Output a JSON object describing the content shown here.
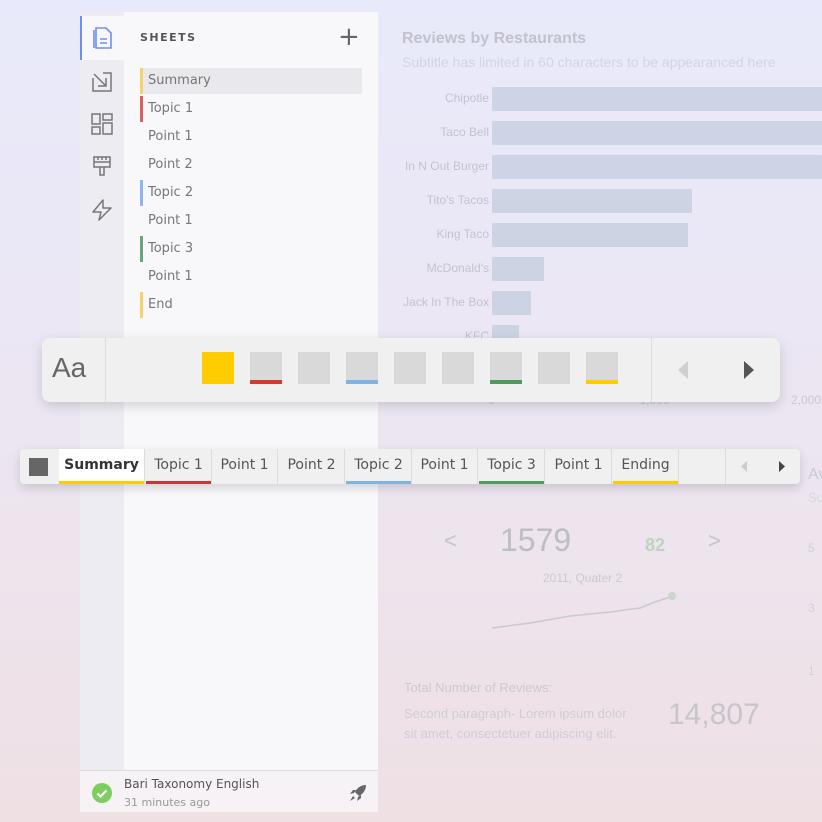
{
  "chart_data": {
    "type": "bar",
    "title": "Reviews by Restaurants",
    "subtitle": "Subtitle has limited in 60 characters to be appearanced here",
    "categories": [
      "Chipotle",
      "Taco Bell",
      "In N Out Burger",
      "Tito's Tacos",
      "King Taco",
      "McDonald's",
      "Jack In The Box",
      "KFC"
    ],
    "values": [
      2400,
      2400,
      2400,
      1320,
      1295,
      340,
      255,
      175
    ],
    "xticks": [
      "0",
      "1,000",
      "2,000"
    ],
    "xlim": [
      0,
      2000
    ],
    "orientation": "horizontal",
    "bar_color": "#c9d2e2"
  },
  "kpi": {
    "value": "1579",
    "delta": "82",
    "period": "2011, Quater 2",
    "prev": "<",
    "next": ">"
  },
  "total": {
    "label": "Total Number of Reviews:",
    "desc": "Second paragraph- Lorem ipsum dolor sit amet, consectetuer adipiscing elit.",
    "value": "14,807"
  },
  "right_peek": {
    "title": "Av",
    "sub": "Su",
    "ticks": [
      "5",
      "3",
      "1"
    ]
  },
  "sidebar": {
    "rail": [
      {
        "icon": "document-icon"
      },
      {
        "icon": "import-icon"
      },
      {
        "icon": "layout-icon"
      },
      {
        "icon": "brush-icon"
      },
      {
        "icon": "lightning-icon"
      }
    ],
    "heading": "SHEETS",
    "add": "+",
    "sheets": [
      {
        "label": "Summary",
        "color": "#f5d36a"
      },
      {
        "label": "Topic 1",
        "color": "#d9605f"
      },
      {
        "label": "Point 1",
        "color": ""
      },
      {
        "label": "Point 2",
        "color": ""
      },
      {
        "label": "Topic 2",
        "color": "#8fb4ee"
      },
      {
        "label": "Point 1",
        "color": ""
      },
      {
        "label": "Topic 3",
        "color": "#6aa57a"
      },
      {
        "label": "Point 1",
        "color": ""
      },
      {
        "label": "End",
        "color": "#f5d36a"
      }
    ],
    "footer": {
      "name": "Bari Taxonomy English",
      "time": "31 minutes ago"
    }
  },
  "format_bar": {
    "font_label": "Aa",
    "swatches": [
      {
        "fill": "#ffcc00",
        "underline": ""
      },
      {
        "fill": "#d9d9d9",
        "underline": "#d23a2f"
      },
      {
        "fill": "#d9d9d9",
        "underline": ""
      },
      {
        "fill": "#d9d9d9",
        "underline": "#7fb2e5"
      },
      {
        "fill": "#d9d9d9",
        "underline": ""
      },
      {
        "fill": "#d9d9d9",
        "underline": ""
      },
      {
        "fill": "#d9d9d9",
        "underline": "#4f9a5f"
      },
      {
        "fill": "#d9d9d9",
        "underline": ""
      },
      {
        "fill": "#d9d9d9",
        "underline": "#ffcc00"
      }
    ]
  },
  "tab_bar": {
    "tabs": [
      {
        "label": "Summary",
        "color": "#ffcc00"
      },
      {
        "label": "Topic 1",
        "color": "#c8363a"
      },
      {
        "label": "Point 1",
        "color": ""
      },
      {
        "label": "Point 2",
        "color": ""
      },
      {
        "label": "Topic 2",
        "color": "#7fb2e5"
      },
      {
        "label": "Point 1",
        "color": ""
      },
      {
        "label": "Topic 3",
        "color": "#4f9a5f"
      },
      {
        "label": "Point 1",
        "color": ""
      },
      {
        "label": "Ending",
        "color": "#ffcc00"
      }
    ]
  }
}
